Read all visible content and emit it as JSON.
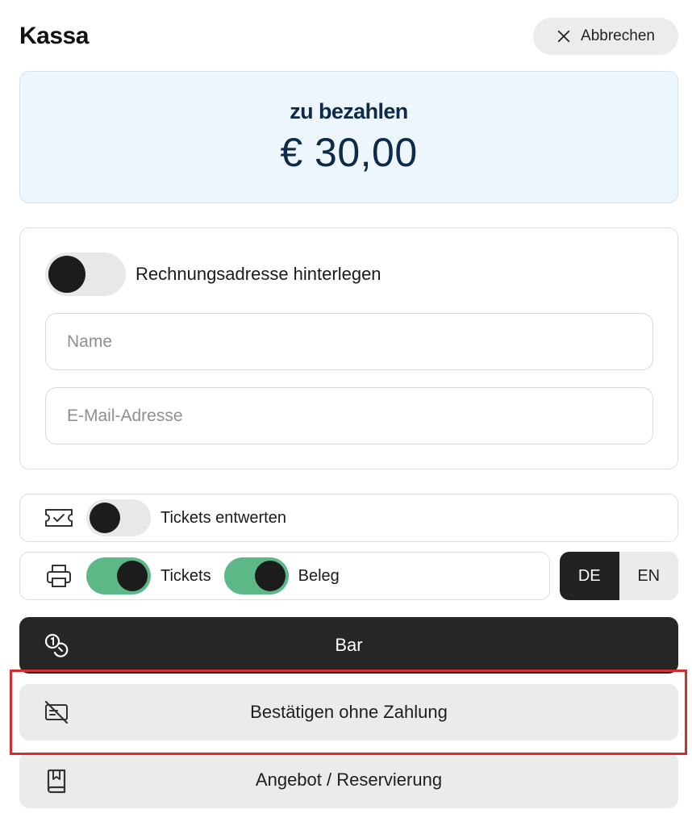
{
  "header": {
    "title": "Kassa",
    "cancel_label": "Abbrechen",
    "cancel_icon": "close-icon"
  },
  "amount": {
    "label": "zu bezahlen",
    "value": "€ 30,00"
  },
  "address": {
    "toggle_label": "Rechnungsadresse hinterlegen",
    "toggle_on": false,
    "name_placeholder": "Name",
    "name_value": "",
    "email_placeholder": "E-Mail-Adresse",
    "email_value": ""
  },
  "tickets_validate": {
    "icon": "ticket-check-icon",
    "label": "Tickets entwerten",
    "on": false
  },
  "print": {
    "icon": "printer-icon",
    "tickets_label": "Tickets",
    "tickets_on": true,
    "receipt_label": "Beleg",
    "receipt_on": true
  },
  "language": {
    "options": [
      "DE",
      "EN"
    ],
    "selected": "DE"
  },
  "actions": {
    "cash_label": "Bar",
    "cash_icon": "coins-icon",
    "confirm_label": "Bestätigen ohne Zahlung",
    "confirm_icon": "no-payment-card-icon",
    "offer_label": "Angebot / Reservierung",
    "offer_icon": "bookmark-book-icon"
  },
  "colors": {
    "toggle_on": "#5cb887",
    "dark_button": "#262626",
    "amount_bg": "#eef6fd",
    "amount_text": "#0d2a4a",
    "highlight": "#d42e2e"
  }
}
